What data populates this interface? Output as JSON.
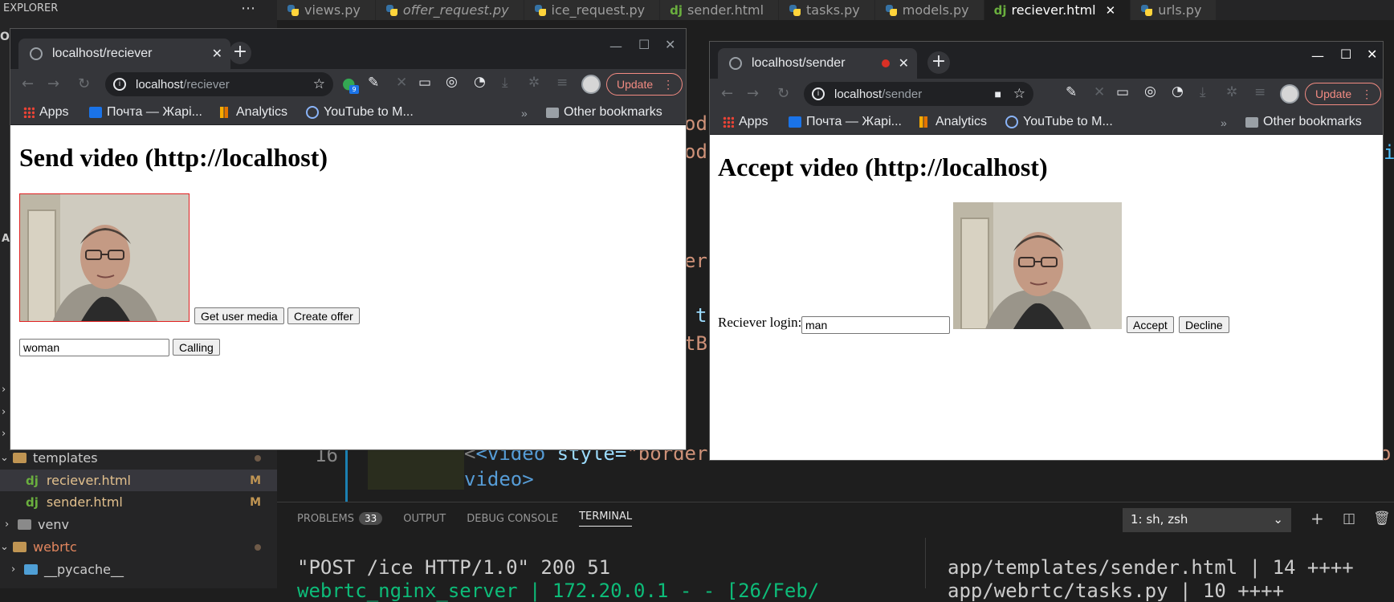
{
  "vscode": {
    "explorer_title": "EXPLORER",
    "tabs": [
      {
        "label": "views.py",
        "icon": "python-icon",
        "italic": false,
        "active": false
      },
      {
        "label": "offer_request.py",
        "icon": "python-icon",
        "italic": true,
        "active": false
      },
      {
        "label": "ice_request.py",
        "icon": "python-icon",
        "italic": false,
        "active": false
      },
      {
        "label": "sender.html",
        "icon": "django-icon",
        "italic": false,
        "active": false
      },
      {
        "label": "tasks.py",
        "icon": "python-icon",
        "italic": false,
        "active": false
      },
      {
        "label": "models.py",
        "icon": "python-icon",
        "italic": false,
        "active": false
      },
      {
        "label": "reciever.html",
        "icon": "django-icon",
        "italic": false,
        "active": true
      },
      {
        "label": "urls.py",
        "icon": "python-icon",
        "italic": false,
        "active": false
      }
    ],
    "django_glyph": "dj",
    "sidebar_stub_o": "O",
    "sidebar_stub_a": "A",
    "tree": {
      "templates": "templates",
      "reciever": "reciever.html",
      "sender": "sender.html",
      "modified_mark": "M",
      "venv": "venv",
      "webrtc": "webrtc",
      "pycache": "__pycache__"
    },
    "editor": {
      "line_number": "16",
      "line16_open": "<video",
      "line16_style": " style=",
      "line16_value": "\"border",
      "line16_tail": "o",
      "line16_wrap": "video>",
      "fragments": [
        "od",
        "od",
        "er",
        "t",
        "tB"
      ],
      "right_edge_glyph": "i"
    },
    "panel": {
      "tabs": [
        "PROBLEMS",
        "OUTPUT",
        "DEBUG CONSOLE",
        "TERMINAL"
      ],
      "problems_count": "33",
      "terminal_select": "1: sh, zsh",
      "term_left": "\"POST /ice HTTP/1.0\" 200 51",
      "term_left2": "webrtc_nginx_server     | 172.20.0.1 - - [26/Feb/",
      "term_right": "app/templates/sender.html    | 14 ++++",
      "term_right2": "app/webrtc/tasks.py          | 10 ++++"
    }
  },
  "browser_left": {
    "tab_title": "localhost/reciever",
    "url_host": "localhost",
    "url_path": "/reciever",
    "update_label": "Update",
    "ext_badge": "9",
    "bookmarks": [
      "Apps",
      "Почта — Жарі...",
      "Analytics",
      "YouTube to M...",
      "Other bookmarks"
    ],
    "heading": "Send video (http://localhost)",
    "get_media_label": "Get user media",
    "create_offer_label": "Create offer",
    "login_value": "woman",
    "calling_label": "Calling"
  },
  "browser_right": {
    "tab_title": "localhost/sender",
    "url_host": "localhost",
    "url_path": "/sender",
    "update_label": "Update",
    "bookmarks": [
      "Apps",
      "Почта — Жарі...",
      "Analytics",
      "YouTube to M...",
      "Other bookmarks"
    ],
    "heading": "Accept video (http://localhost)",
    "login_label": "Reciever login:",
    "login_value": "man",
    "accept_label": "Accept",
    "decline_label": "Decline"
  },
  "colors": {
    "vscode_bg": "#1e1e1e",
    "chrome_dark": "#202124",
    "update_accent": "#f28b82",
    "video_border": "#e02020"
  }
}
